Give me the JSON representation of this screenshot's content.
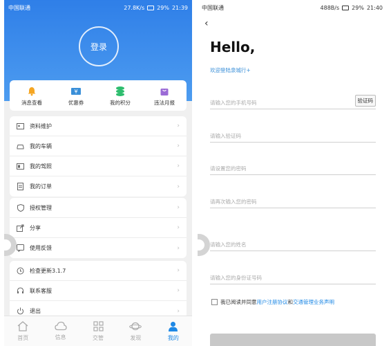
{
  "left": {
    "statusbar": {
      "carrier": "中国联通",
      "speed": "27.8K/s",
      "battery": "29%",
      "time": "21:39"
    },
    "login_label": "登录",
    "quick_actions": [
      {
        "label": "消息查看",
        "icon": "bell-icon",
        "color": "#f5a623"
      },
      {
        "label": "优惠券",
        "icon": "coupon-icon",
        "color": "#3a8fd8"
      },
      {
        "label": "我的积分",
        "icon": "coins-icon",
        "color": "#2ebd6e"
      },
      {
        "label": "违法月报",
        "icon": "bag-icon",
        "color": "#9b6bd6"
      }
    ],
    "menu_group_1": [
      {
        "label": "资料维护",
        "icon": "profile-card-icon"
      },
      {
        "label": "我的车辆",
        "icon": "car-icon"
      },
      {
        "label": "我的驾照",
        "icon": "license-icon"
      },
      {
        "label": "我的订单",
        "icon": "order-icon"
      }
    ],
    "menu_group_2": [
      {
        "label": "授权管理",
        "icon": "shield-icon"
      },
      {
        "label": "分享",
        "icon": "share-icon"
      },
      {
        "label": "使用反馈",
        "icon": "feedback-icon"
      }
    ],
    "menu_group_3": [
      {
        "label": "检查更新3.1.7",
        "icon": "update-icon"
      },
      {
        "label": "联系客服",
        "icon": "headset-icon"
      },
      {
        "label": "退出",
        "icon": "power-icon"
      }
    ],
    "tabs": [
      {
        "label": "首页",
        "icon": "home-icon"
      },
      {
        "label": "信息",
        "icon": "cloud-icon"
      },
      {
        "label": "交管",
        "icon": "grid-icon"
      },
      {
        "label": "发现",
        "icon": "planet-icon"
      },
      {
        "label": "我的",
        "icon": "person-icon",
        "active": true
      }
    ],
    "accent": "#1e88e5"
  },
  "right": {
    "statusbar": {
      "carrier": "中国联通",
      "speed": "488B/s",
      "battery": "29%",
      "time": "21:40"
    },
    "title": "Hello,",
    "welcome": "欢迎登陆泉城行+",
    "fields": {
      "phone_placeholder": "请输入您的手机号码",
      "code_placeholder": "请输入验证码",
      "password_placeholder": "请设置您的密码",
      "password_confirm_placeholder": "请再次输入您的密码",
      "name_placeholder": "请输入您的姓名",
      "idcard_placeholder": "请输入您的身份证号码"
    },
    "code_button": "验证码",
    "agree": {
      "prefix": "我已阅读并同意",
      "link1": "用户注册协议",
      "and": "和",
      "link2": "交通管理业务声明"
    }
  }
}
